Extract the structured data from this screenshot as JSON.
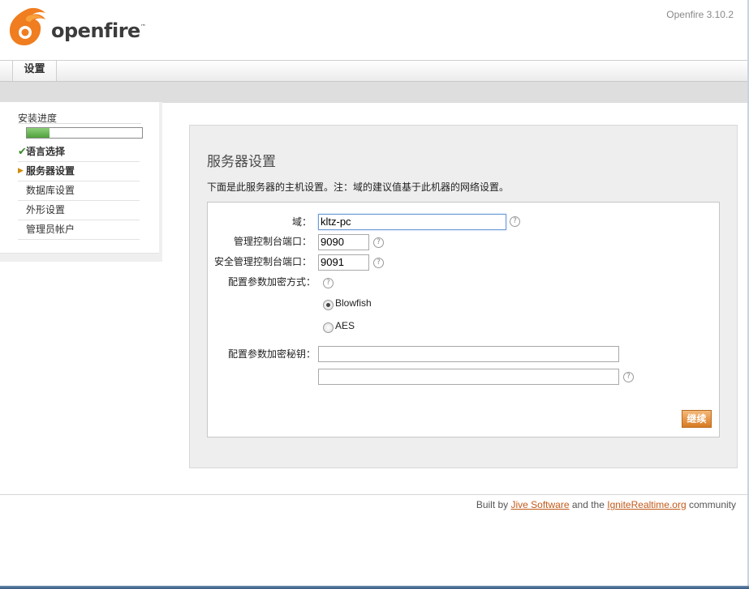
{
  "header": {
    "logo_text": "openfire",
    "logo_tm": "™",
    "version": "Openfire 3.10.2"
  },
  "tabs": [
    {
      "label": "设置",
      "active": true
    }
  ],
  "sidebar": {
    "progress_label": "安装进度",
    "progress_fraction": 0.2,
    "items": [
      {
        "label": "语言选择",
        "state": "done",
        "marker": "✔"
      },
      {
        "label": "服务器设置",
        "state": "current",
        "marker": "▶"
      },
      {
        "label": "数据库设置",
        "state": "pending",
        "marker": ""
      },
      {
        "label": "外形设置",
        "state": "pending",
        "marker": ""
      },
      {
        "label": "管理员帐户",
        "state": "pending",
        "marker": ""
      }
    ]
  },
  "main": {
    "title": "服务器设置",
    "description": "下面是此服务器的主机设置。注：域的建议值基于此机器的网络设置。",
    "form": {
      "domain_label": "域：",
      "domain_value": "kltz-pc",
      "admin_port_label": "管理控制台端口：",
      "admin_port_value": "9090",
      "secure_port_label": "安全管理控制台端口：",
      "secure_port_value": "9091",
      "encryption_label": "配置参数加密方式：",
      "encryption_options": [
        {
          "label": "Blowfish",
          "selected": true
        },
        {
          "label": "AES",
          "selected": false
        }
      ],
      "encryption_key_label": "配置参数加密秘钥：",
      "encryption_key_value": "",
      "encryption_key_confirm_value": "",
      "help_glyph": "?",
      "continue_label": "继续"
    }
  },
  "footer": {
    "prefix": "Built by ",
    "link1": "Jive Software",
    "middle": " and the ",
    "link2": "IgniteRealtime.org",
    "suffix": " community"
  },
  "colors": {
    "accent": "#d77a22",
    "link": "#c25a1a",
    "progress": "#4fa03b"
  }
}
